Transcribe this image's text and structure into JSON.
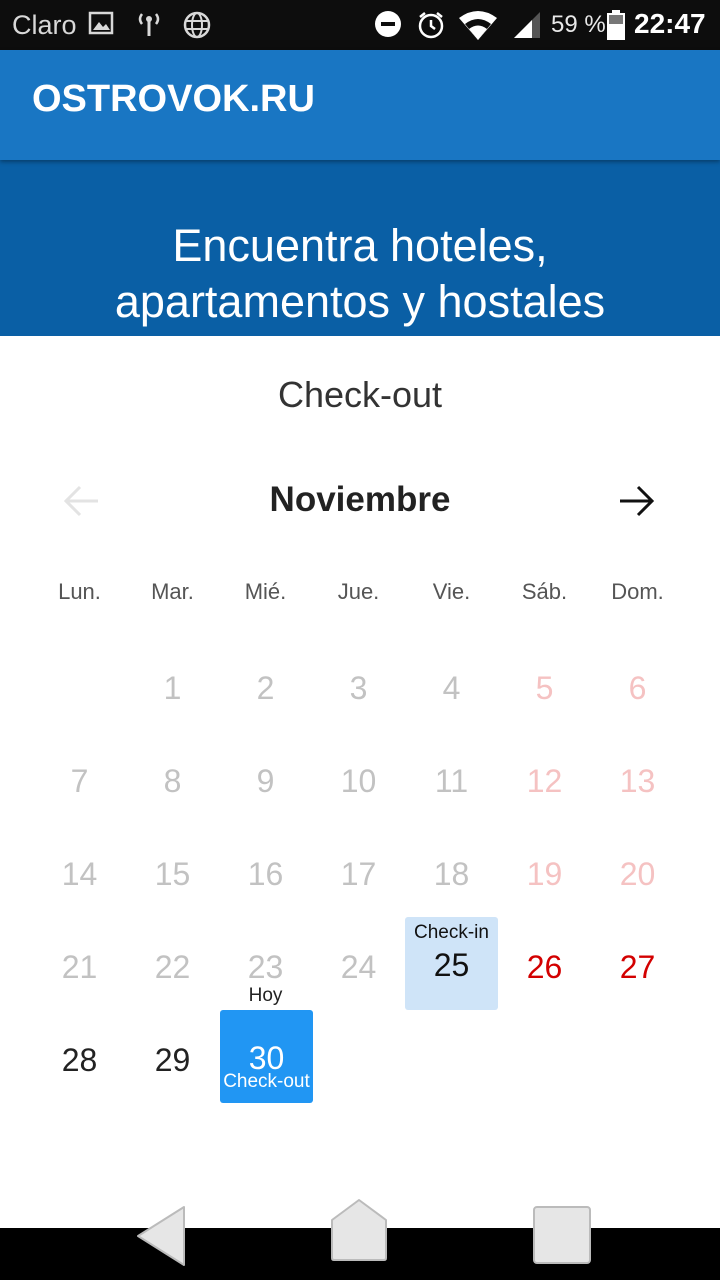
{
  "status_bar": {
    "carrier": "Claro",
    "battery_percent": "59 %",
    "time": "22:47",
    "icons": [
      "image-icon",
      "hotspot-icon",
      "globe-icon",
      "do-not-disturb-icon",
      "alarm-icon",
      "wifi-icon",
      "signal-icon",
      "battery-icon"
    ]
  },
  "app_bar": {
    "logo": "OSTROVOK.RU"
  },
  "hero": {
    "line1": "Encuentra hoteles,",
    "line2": "apartamentos y hostales"
  },
  "calendar": {
    "title": "Check-out",
    "month": "Noviembre",
    "weekdays": [
      "Lun.",
      "Mar.",
      "Mié.",
      "Jue.",
      "Vie.",
      "Sáb.",
      "Dom."
    ],
    "check_in_label": "Check-in",
    "check_out_label": "Check-out",
    "today_label": "Hoy",
    "days": {
      "d1": "1",
      "d2": "2",
      "d3": "3",
      "d4": "4",
      "d5": "5",
      "d6": "6",
      "d7": "7",
      "d8": "8",
      "d9": "9",
      "d10": "10",
      "d11": "11",
      "d12": "12",
      "d13": "13",
      "d14": "14",
      "d15": "15",
      "d16": "16",
      "d17": "17",
      "d18": "18",
      "d19": "19",
      "d20": "20",
      "d21": "21",
      "d22": "22",
      "d23": "23",
      "d24": "24",
      "d25": "25",
      "d26": "26",
      "d27": "27",
      "d28": "28",
      "d29": "29",
      "d30": "30"
    },
    "colors": {
      "check_in_bg": "#cfe4f8",
      "check_out_bg": "#2196f3",
      "weekend_active": "#d30000",
      "disabled": "#c2c2c2"
    }
  }
}
